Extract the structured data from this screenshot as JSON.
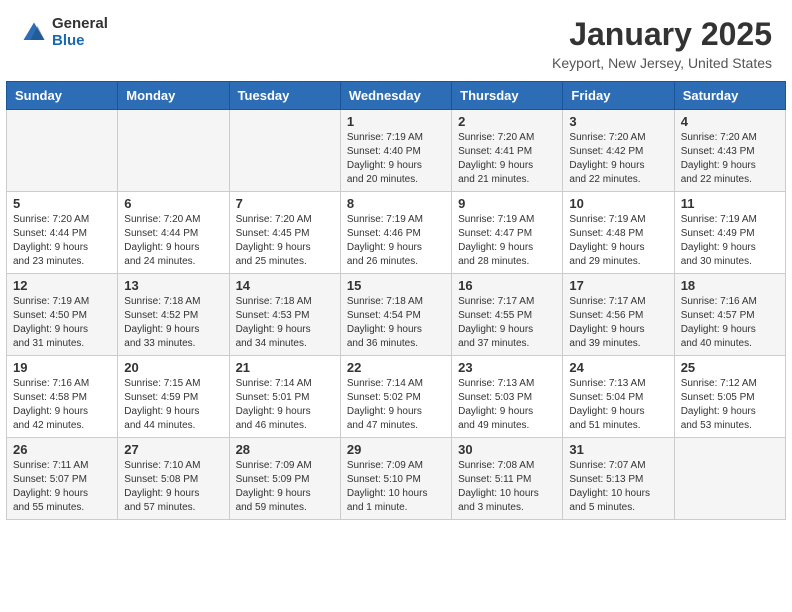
{
  "logo": {
    "general": "General",
    "blue": "Blue"
  },
  "header": {
    "month": "January 2025",
    "location": "Keyport, New Jersey, United States"
  },
  "weekdays": [
    "Sunday",
    "Monday",
    "Tuesday",
    "Wednesday",
    "Thursday",
    "Friday",
    "Saturday"
  ],
  "weeks": [
    [
      {
        "day": "",
        "info": ""
      },
      {
        "day": "",
        "info": ""
      },
      {
        "day": "",
        "info": ""
      },
      {
        "day": "1",
        "info": "Sunrise: 7:19 AM\nSunset: 4:40 PM\nDaylight: 9 hours\nand 20 minutes."
      },
      {
        "day": "2",
        "info": "Sunrise: 7:20 AM\nSunset: 4:41 PM\nDaylight: 9 hours\nand 21 minutes."
      },
      {
        "day": "3",
        "info": "Sunrise: 7:20 AM\nSunset: 4:42 PM\nDaylight: 9 hours\nand 22 minutes."
      },
      {
        "day": "4",
        "info": "Sunrise: 7:20 AM\nSunset: 4:43 PM\nDaylight: 9 hours\nand 22 minutes."
      }
    ],
    [
      {
        "day": "5",
        "info": "Sunrise: 7:20 AM\nSunset: 4:44 PM\nDaylight: 9 hours\nand 23 minutes."
      },
      {
        "day": "6",
        "info": "Sunrise: 7:20 AM\nSunset: 4:44 PM\nDaylight: 9 hours\nand 24 minutes."
      },
      {
        "day": "7",
        "info": "Sunrise: 7:20 AM\nSunset: 4:45 PM\nDaylight: 9 hours\nand 25 minutes."
      },
      {
        "day": "8",
        "info": "Sunrise: 7:19 AM\nSunset: 4:46 PM\nDaylight: 9 hours\nand 26 minutes."
      },
      {
        "day": "9",
        "info": "Sunrise: 7:19 AM\nSunset: 4:47 PM\nDaylight: 9 hours\nand 28 minutes."
      },
      {
        "day": "10",
        "info": "Sunrise: 7:19 AM\nSunset: 4:48 PM\nDaylight: 9 hours\nand 29 minutes."
      },
      {
        "day": "11",
        "info": "Sunrise: 7:19 AM\nSunset: 4:49 PM\nDaylight: 9 hours\nand 30 minutes."
      }
    ],
    [
      {
        "day": "12",
        "info": "Sunrise: 7:19 AM\nSunset: 4:50 PM\nDaylight: 9 hours\nand 31 minutes."
      },
      {
        "day": "13",
        "info": "Sunrise: 7:18 AM\nSunset: 4:52 PM\nDaylight: 9 hours\nand 33 minutes."
      },
      {
        "day": "14",
        "info": "Sunrise: 7:18 AM\nSunset: 4:53 PM\nDaylight: 9 hours\nand 34 minutes."
      },
      {
        "day": "15",
        "info": "Sunrise: 7:18 AM\nSunset: 4:54 PM\nDaylight: 9 hours\nand 36 minutes."
      },
      {
        "day": "16",
        "info": "Sunrise: 7:17 AM\nSunset: 4:55 PM\nDaylight: 9 hours\nand 37 minutes."
      },
      {
        "day": "17",
        "info": "Sunrise: 7:17 AM\nSunset: 4:56 PM\nDaylight: 9 hours\nand 39 minutes."
      },
      {
        "day": "18",
        "info": "Sunrise: 7:16 AM\nSunset: 4:57 PM\nDaylight: 9 hours\nand 40 minutes."
      }
    ],
    [
      {
        "day": "19",
        "info": "Sunrise: 7:16 AM\nSunset: 4:58 PM\nDaylight: 9 hours\nand 42 minutes."
      },
      {
        "day": "20",
        "info": "Sunrise: 7:15 AM\nSunset: 4:59 PM\nDaylight: 9 hours\nand 44 minutes."
      },
      {
        "day": "21",
        "info": "Sunrise: 7:14 AM\nSunset: 5:01 PM\nDaylight: 9 hours\nand 46 minutes."
      },
      {
        "day": "22",
        "info": "Sunrise: 7:14 AM\nSunset: 5:02 PM\nDaylight: 9 hours\nand 47 minutes."
      },
      {
        "day": "23",
        "info": "Sunrise: 7:13 AM\nSunset: 5:03 PM\nDaylight: 9 hours\nand 49 minutes."
      },
      {
        "day": "24",
        "info": "Sunrise: 7:13 AM\nSunset: 5:04 PM\nDaylight: 9 hours\nand 51 minutes."
      },
      {
        "day": "25",
        "info": "Sunrise: 7:12 AM\nSunset: 5:05 PM\nDaylight: 9 hours\nand 53 minutes."
      }
    ],
    [
      {
        "day": "26",
        "info": "Sunrise: 7:11 AM\nSunset: 5:07 PM\nDaylight: 9 hours\nand 55 minutes."
      },
      {
        "day": "27",
        "info": "Sunrise: 7:10 AM\nSunset: 5:08 PM\nDaylight: 9 hours\nand 57 minutes."
      },
      {
        "day": "28",
        "info": "Sunrise: 7:09 AM\nSunset: 5:09 PM\nDaylight: 9 hours\nand 59 minutes."
      },
      {
        "day": "29",
        "info": "Sunrise: 7:09 AM\nSunset: 5:10 PM\nDaylight: 10 hours\nand 1 minute."
      },
      {
        "day": "30",
        "info": "Sunrise: 7:08 AM\nSunset: 5:11 PM\nDaylight: 10 hours\nand 3 minutes."
      },
      {
        "day": "31",
        "info": "Sunrise: 7:07 AM\nSunset: 5:13 PM\nDaylight: 10 hours\nand 5 minutes."
      },
      {
        "day": "",
        "info": ""
      }
    ]
  ]
}
